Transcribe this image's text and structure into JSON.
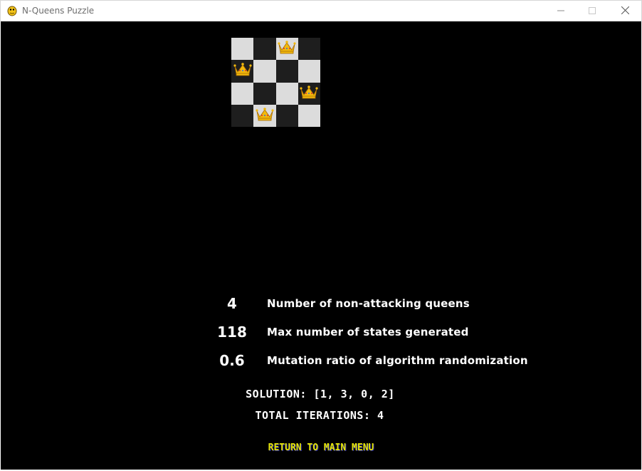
{
  "window": {
    "title": "N-Queens Puzzle",
    "controls": {
      "minimize": "minimize-icon",
      "maximize": "maximize-icon",
      "close": "close-icon"
    }
  },
  "board": {
    "size": 4,
    "queen_icon": "crown-icon",
    "queen_color": "#f2b90d",
    "cells": [
      [
        "light",
        "dark",
        "light",
        "dark"
      ],
      [
        "dark",
        "light",
        "dark",
        "light"
      ],
      [
        "light",
        "dark",
        "light",
        "dark"
      ],
      [
        "dark",
        "light",
        "dark",
        "light"
      ]
    ],
    "queens_by_row": [
      2,
      0,
      3,
      1
    ]
  },
  "stats": [
    {
      "value": "4",
      "label": "Number of non-attacking queens"
    },
    {
      "value": "118",
      "label": "Max number of states generated"
    },
    {
      "value": "0.6",
      "label": "Mutation ratio of algorithm randomization"
    }
  ],
  "results": {
    "solution": "SOLUTION: [1, 3, 0, 2]",
    "iterations": "TOTAL ITERATIONS: 4"
  },
  "actions": {
    "return_label": "RETURN TO MAIN MENU"
  },
  "colors": {
    "background": "#000000",
    "text": "#ffffff",
    "accent_yellow": "#e6e600",
    "light_square": "#dcdcdc",
    "dark_square": "#1e1e1e"
  }
}
